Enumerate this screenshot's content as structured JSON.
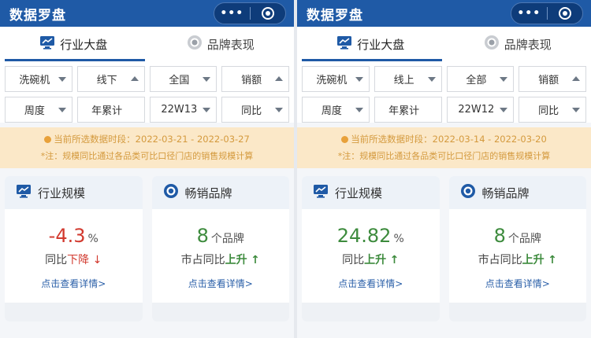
{
  "colors": {
    "brand": "#1f5aa6",
    "down": "#d23a2f",
    "up": "#3d8b3d",
    "notice_bg": "#fbe8c8",
    "notice_text": "#d49a3e",
    "link": "#2a5fa8"
  },
  "panels": [
    {
      "app_title": "数据罗盘",
      "capsule": {
        "more_icon": "•••",
        "close_icon": "target-icon"
      },
      "tabs": [
        {
          "label": "行业大盘",
          "icon": "monitor-chart-icon",
          "active": true
        },
        {
          "label": "品牌表现",
          "icon": "medal-icon",
          "active": false
        }
      ],
      "filters": {
        "row1": [
          {
            "value": "洗碗机",
            "arrow": "down"
          },
          {
            "value": "线下",
            "arrow": "up"
          },
          {
            "value": "全国",
            "arrow": "down"
          },
          {
            "value": "销额",
            "arrow": "up"
          }
        ],
        "row2": [
          {
            "value": "周度",
            "arrow": "down"
          },
          {
            "value": "年累计",
            "arrow": ""
          },
          {
            "value": "22W13",
            "arrow": "down"
          },
          {
            "value": "同比",
            "arrow": "down"
          }
        ]
      },
      "notice": {
        "line1": "当前所选数据时段：2022-03-21 - 2022-03-27",
        "line2": "*注：规模同比通过各品类可比口径门店的销售规模计算"
      },
      "cards": [
        {
          "title": "行业规模",
          "icon": "chart-monitor-icon",
          "value": "-4.3",
          "unit": "%",
          "sub_prefix": "同比",
          "sub_trend": "下降",
          "sub_arrow": "↓",
          "direction": "down",
          "detail": "点击查看详情>"
        },
        {
          "title": "畅销品牌",
          "icon": "badge-icon",
          "value": "8",
          "unit": "个品牌",
          "sub_prefix": "市占同比",
          "sub_trend": "上升",
          "sub_arrow": "↑",
          "direction": "up",
          "detail": "点击查看详情>"
        }
      ]
    },
    {
      "app_title": "数据罗盘",
      "capsule": {
        "more_icon": "•••",
        "close_icon": "target-icon"
      },
      "tabs": [
        {
          "label": "行业大盘",
          "icon": "monitor-chart-icon",
          "active": true
        },
        {
          "label": "品牌表现",
          "icon": "medal-icon",
          "active": false
        }
      ],
      "filters": {
        "row1": [
          {
            "value": "洗碗机",
            "arrow": "down"
          },
          {
            "value": "线上",
            "arrow": "down"
          },
          {
            "value": "全部",
            "arrow": "down"
          },
          {
            "value": "销额",
            "arrow": "up"
          }
        ],
        "row2": [
          {
            "value": "周度",
            "arrow": "down"
          },
          {
            "value": "年累计",
            "arrow": ""
          },
          {
            "value": "22W12",
            "arrow": "down"
          },
          {
            "value": "同比",
            "arrow": "down"
          }
        ]
      },
      "notice": {
        "line1": "当前所选数据时段：2022-03-14 - 2022-03-20",
        "line2": "*注：规模同比通过各品类可比口径门店的销售规模计算"
      },
      "cards": [
        {
          "title": "行业规模",
          "icon": "chart-monitor-icon",
          "value": "24.82",
          "unit": "%",
          "sub_prefix": "同比",
          "sub_trend": "上升",
          "sub_arrow": "↑",
          "direction": "up",
          "detail": "点击查看详情>"
        },
        {
          "title": "畅销品牌",
          "icon": "badge-icon",
          "value": "8",
          "unit": "个品牌",
          "sub_prefix": "市占同比",
          "sub_trend": "上升",
          "sub_arrow": "↑",
          "direction": "up",
          "detail": "点击查看详情>"
        }
      ]
    }
  ]
}
